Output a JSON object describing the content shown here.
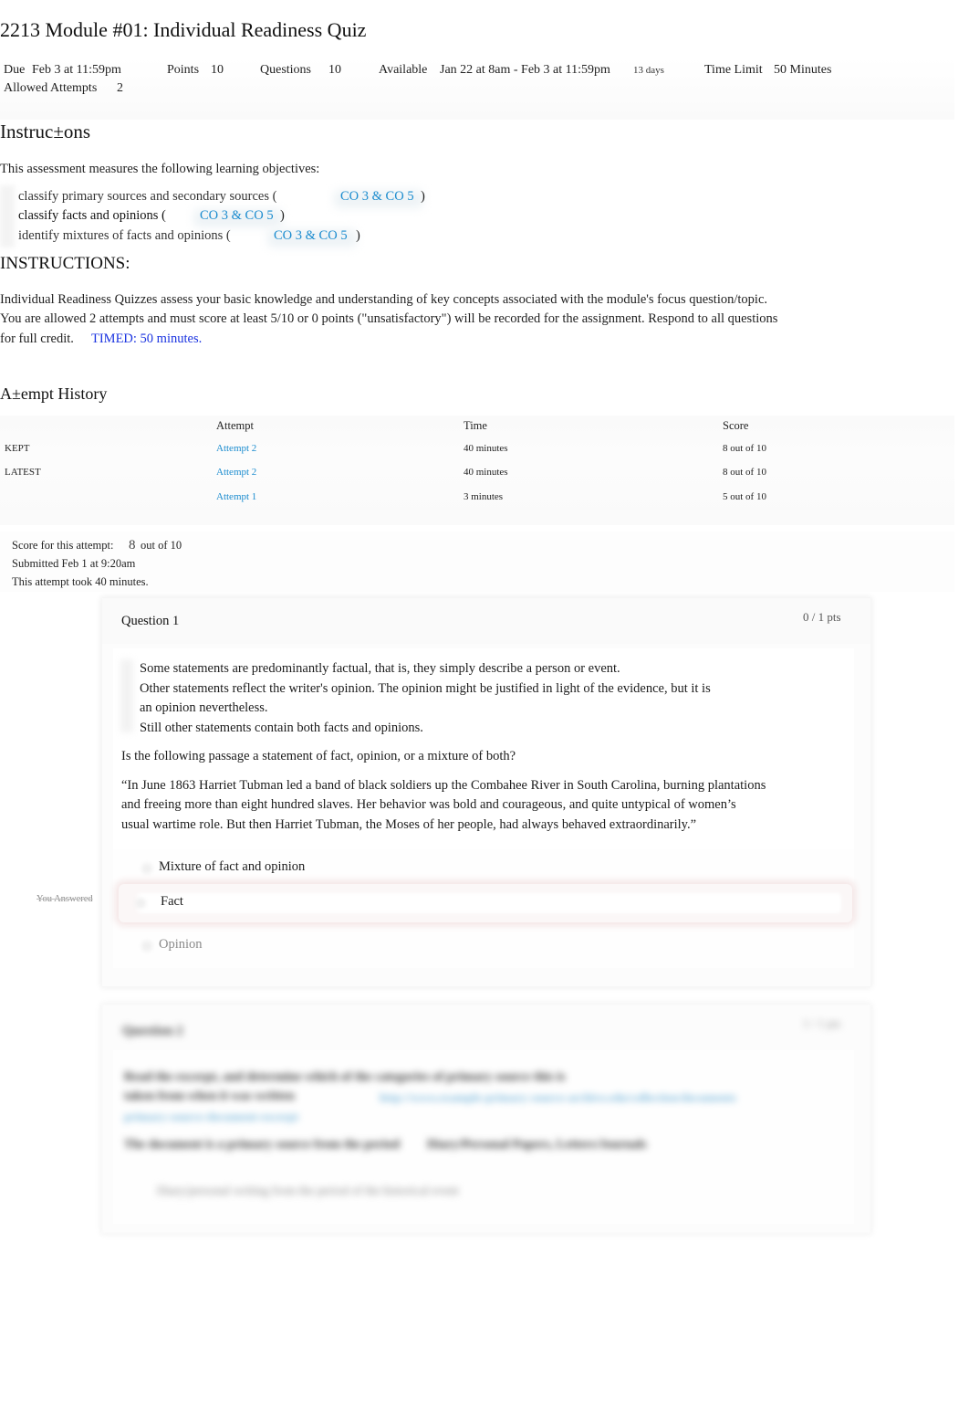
{
  "page": {
    "title": "2213 Module #01: Individual Readiness Quiz"
  },
  "details": {
    "due_label": "Due",
    "due_value": "Feb 3 at 11:59pm",
    "points_label": "Points",
    "points_value": "10",
    "questions_label": "Questions",
    "questions_value": "10",
    "available_label": "Available",
    "available_value": "Jan 22 at 8am - Feb 3 at 11:59pm",
    "available_duration": "13 days",
    "time_limit_label": "Time Limit",
    "time_limit_value": "50 Minutes",
    "allowed_attempts_label": "Allowed Attempts",
    "allowed_attempts_value": "2"
  },
  "instructions": {
    "heading": "Instruc±ons",
    "intro": "This assessment measures the following learning objectives:",
    "objectives": [
      {
        "text": "classify primary sources and secondary sources (",
        "link": "CO 3 & CO 5",
        "close": ")"
      },
      {
        "text": "classify facts and opinions (",
        "link": "CO 3 & CO 5",
        "close": ")"
      },
      {
        "text": "identify mixtures of facts and opinions (",
        "link": "CO 3 & CO 5",
        "close": ")"
      }
    ],
    "subheading": "INSTRUCTIONS:",
    "paragraph_lines": [
      "Individual Readiness Quizzes assess your basic knowledge and understanding of key concepts associated with the module's focus question/topic.",
      "You are allowed 2 attempts and must score at least 5/10 or 0 points (\"unsatisfactory\") will be recorded for the assignment. Respond to all questions",
      "for full credit."
    ],
    "timed_note": "TIMED: 50 minutes."
  },
  "attempt_history": {
    "heading": "A±empt History",
    "columns": [
      "",
      "Attempt",
      "Time",
      "Score"
    ],
    "rows": [
      {
        "label": "KEPT",
        "attempt": "Attempt 2",
        "time": "40 minutes",
        "score": "8 out of 10"
      },
      {
        "label": "LATEST",
        "attempt": "Attempt 2",
        "time": "40 minutes",
        "score": "8 out of 10"
      },
      {
        "label": "",
        "attempt": "Attempt 1",
        "time": "3 minutes",
        "score": "5 out of 10"
      }
    ]
  },
  "current_attempt": {
    "score_label": "Score for this attempt:",
    "score_value": "8",
    "score_total": "out of 10",
    "submitted": "Submitted Feb 1 at 9:20am",
    "duration": "This attempt took 40 minutes."
  },
  "questions": [
    {
      "title": "Question 1",
      "points": "0 / 1 pts",
      "bullets": [
        "Some statements are predominantly factual, that is, they simply describe a person or event.",
        "Other statements reflect the writer's opinion. The opinion might be justified in light of the evidence, but it is",
        "an opinion nevertheless.",
        "Still other statements contain both facts and opinions."
      ],
      "prompt": "Is the following passage a statement of fact, opinion, or a mixture of both?",
      "passage_lines": [
        "“In June 1863 Harriet Tubman led a band of black soldiers up the Combahee River in South Carolina, burning plantations",
        "and freeing more than eight hundred slaves. Her behavior was bold and courageous, and quite untypical of women’s",
        "usual wartime role. But then Harriet Tubman, the Moses of her people, had always behaved extraordinarily.”"
      ],
      "answers": [
        {
          "text": "Mixture of fact and opinion",
          "state": "none"
        },
        {
          "text": "Fact",
          "state": "selected-wrong"
        },
        {
          "text": "Opinion",
          "state": "muted"
        }
      ],
      "you_answered_label": "You Answered"
    },
    {
      "title": "Question 2",
      "points": "1 / 1 pts",
      "blurred": true,
      "line1": "Read the excerpt, and determine which of the categories of primary source this is",
      "line2": "taken from when it was written",
      "link1": "http://www.example-primary-source-archive.edu/collection/documents",
      "link2": "primary-source-document-excerpt",
      "line3": "The document is a primary source from the period",
      "line4": "Diary/Personal Papers, Letters/Journals",
      "answer": "Diary/personal writing from the period of the historical event"
    }
  ]
}
